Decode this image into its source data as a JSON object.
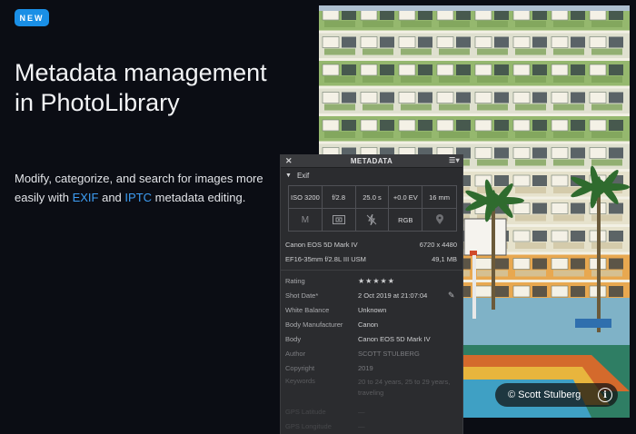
{
  "badge": "NEW",
  "title": "Metadata management in PhotoLibrary",
  "description": {
    "text1": "Modify, categorize, and search for images more easily with ",
    "link1": "EXIF",
    "text2": " and ",
    "link2": "IPTC",
    "text3": " metadata editing."
  },
  "credit": {
    "text": "© Scott Stulberg",
    "icon": "info-icon"
  },
  "panel": {
    "title": "METADATA",
    "close_icon": "close-icon",
    "menu_icon": "panel-menu-icon",
    "section": "Exif",
    "exif_top": [
      "ISO 3200",
      "f/2.8",
      "25.0 s",
      "+0.0 EV",
      "16 mm"
    ],
    "exif_bottom": [
      {
        "text": "M",
        "icon": "exposure-mode"
      },
      {
        "text": "",
        "icon": "metering-icon"
      },
      {
        "text": "",
        "icon": "flash-off-icon"
      },
      {
        "text": "RGB",
        "icon": "color-space"
      },
      {
        "text": "",
        "icon": "location-icon"
      }
    ],
    "camera": "Canon EOS 5D Mark IV",
    "resolution": "6720 x 4480",
    "lens": "EF16-35mm f/2.8L III USM",
    "filesize": "49,1 MB",
    "rows": [
      {
        "key": "Rating",
        "value": "★★★★★"
      },
      {
        "key": "Shot Date*",
        "value": "2 Oct 2019 at 21:07:04"
      },
      {
        "key": "White Balance",
        "value": "Unknown"
      },
      {
        "key": "Body Manufacturer",
        "value": "Canon"
      },
      {
        "key": "Body",
        "value": "Canon EOS 5D Mark IV"
      },
      {
        "key": "Author",
        "value": "SCOTT STULBERG"
      },
      {
        "key": "Copyright",
        "value": "2019"
      },
      {
        "key": "Keywords",
        "value": "20 to 24 years, 25 to 29 years, traveling"
      },
      {
        "key": "GPS Latitude",
        "value": "—"
      },
      {
        "key": "GPS Longitude",
        "value": "—"
      }
    ]
  }
}
